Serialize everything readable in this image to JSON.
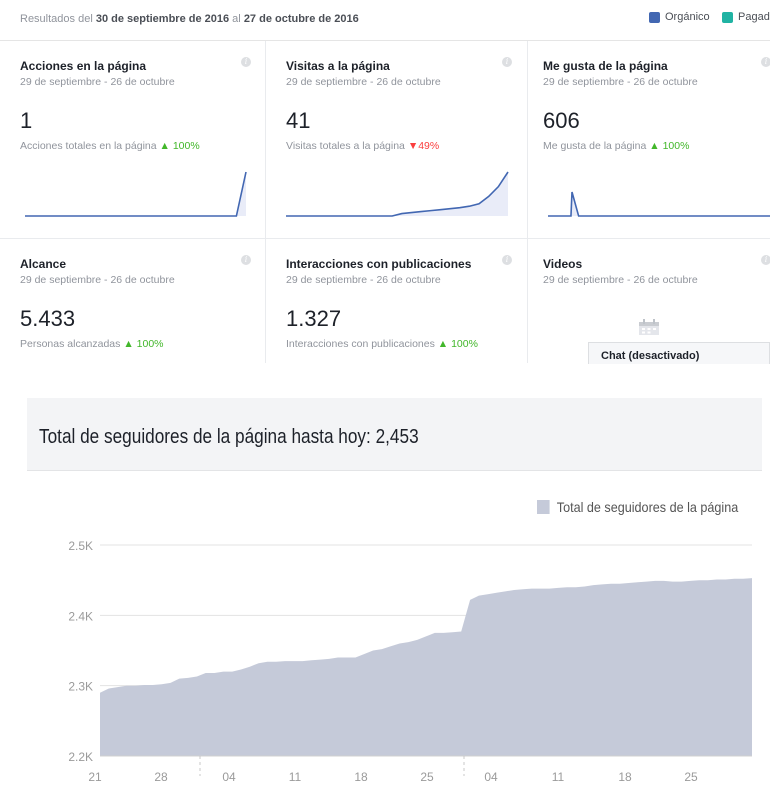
{
  "topbar": {
    "results_prefix": "Resultados del ",
    "date_from": "30 de septiembre de 2016",
    "results_mid": " al ",
    "date_to": "27 de octubre de 2016",
    "legend": [
      {
        "label": "Orgánico",
        "color": "#4267b2"
      },
      {
        "label": "Pagad",
        "color": "#20b3a3"
      }
    ]
  },
  "cards": [
    {
      "title": "Acciones en la página",
      "range": "29 de septiembre - 26 de octubre",
      "value": "1",
      "metric": "Acciones totales en la página",
      "trend": "up",
      "trend_arrow": "▲",
      "change": "100%",
      "spark": [
        0,
        0,
        0,
        0,
        0,
        0,
        0,
        0,
        0,
        0,
        0,
        0,
        0,
        0,
        0,
        0,
        0,
        0,
        0,
        0,
        0,
        0,
        0,
        1
      ]
    },
    {
      "title": "Visitas a la página",
      "range": "29 de septiembre - 26 de octubre",
      "value": "41",
      "metric": "Visitas totales a la página",
      "trend": "down",
      "trend_arrow": "▼",
      "change": "49%",
      "spark": [
        0,
        0,
        0,
        0,
        0,
        0,
        0,
        0,
        0,
        0,
        0,
        0,
        0.5,
        0.7,
        0.9,
        1.1,
        1.3,
        1.5,
        1.7,
        2,
        2.5,
        4,
        6,
        9
      ]
    },
    {
      "title": "Me gusta de la página",
      "range": "29 de septiembre - 26 de octubre",
      "value": "606",
      "metric": "Me gusta de la página",
      "trend": "up",
      "trend_arrow": "▲",
      "change": "100%",
      "spark": [
        0,
        0,
        0,
        0,
        0,
        0,
        0,
        0,
        0,
        0,
        0,
        0,
        0,
        0,
        0,
        0,
        0,
        0,
        0,
        0,
        0,
        0,
        0,
        0,
        0,
        0,
        0,
        0,
        0,
        0
      ]
    },
    {
      "title": "Alcance",
      "range": "29 de septiembre - 26 de octubre",
      "value": "5.433",
      "metric": "Personas alcanzadas",
      "trend": "up",
      "trend_arrow": "▲",
      "change": "100%"
    },
    {
      "title": "Interacciones con publicaciones",
      "range": "29 de septiembre - 26 de octubre",
      "value": "1.327",
      "metric": "Interacciones con publicaciones",
      "trend": "up",
      "trend_arrow": "▲",
      "change": "100%"
    },
    {
      "title": "Videos",
      "range": "29 de septiembre - 26 de octubre"
    }
  ],
  "chat": {
    "label": "Chat (desactivado)"
  },
  "icons": {
    "info": "info-icon",
    "calendar": "calendar-icon"
  },
  "followers": {
    "title": "Total de seguidores de la página hasta hoy: 2,453",
    "legend": "Total de seguidores de la página",
    "color": "#c5cad9"
  },
  "chart_data": {
    "type": "area",
    "title": "",
    "xlabel": "",
    "ylabel": "",
    "ylim": [
      2200,
      2500
    ],
    "yticks": [
      "2.2K",
      "2.3K",
      "2.4K",
      "2.5K"
    ],
    "yticks_values": [
      2200,
      2300,
      2400,
      2500
    ],
    "xticks": [
      "21",
      "28",
      "04",
      "11",
      "18",
      "25",
      "04",
      "11",
      "18",
      "25"
    ],
    "grid": true,
    "legend_position": "top-right",
    "series": [
      {
        "name": "Total de seguidores de la página",
        "values": [
          2290,
          2296,
          2298,
          2300,
          2300,
          2301,
          2301,
          2302,
          2304,
          2310,
          2311,
          2313,
          2318,
          2318,
          2320,
          2320,
          2323,
          2327,
          2332,
          2334,
          2334,
          2335,
          2335,
          2335,
          2336,
          2337,
          2338,
          2340,
          2340,
          2340,
          2345,
          2350,
          2352,
          2356,
          2360,
          2362,
          2365,
          2370,
          2375,
          2375,
          2376,
          2377,
          2422,
          2428,
          2430,
          2432,
          2434,
          2436,
          2437,
          2438,
          2438,
          2438,
          2439,
          2440,
          2440,
          2441,
          2443,
          2444,
          2445,
          2445,
          2446,
          2447,
          2448,
          2449,
          2449,
          2448,
          2448,
          2449,
          2450,
          2450,
          2451,
          2451,
          2452,
          2452,
          2453
        ]
      }
    ]
  }
}
